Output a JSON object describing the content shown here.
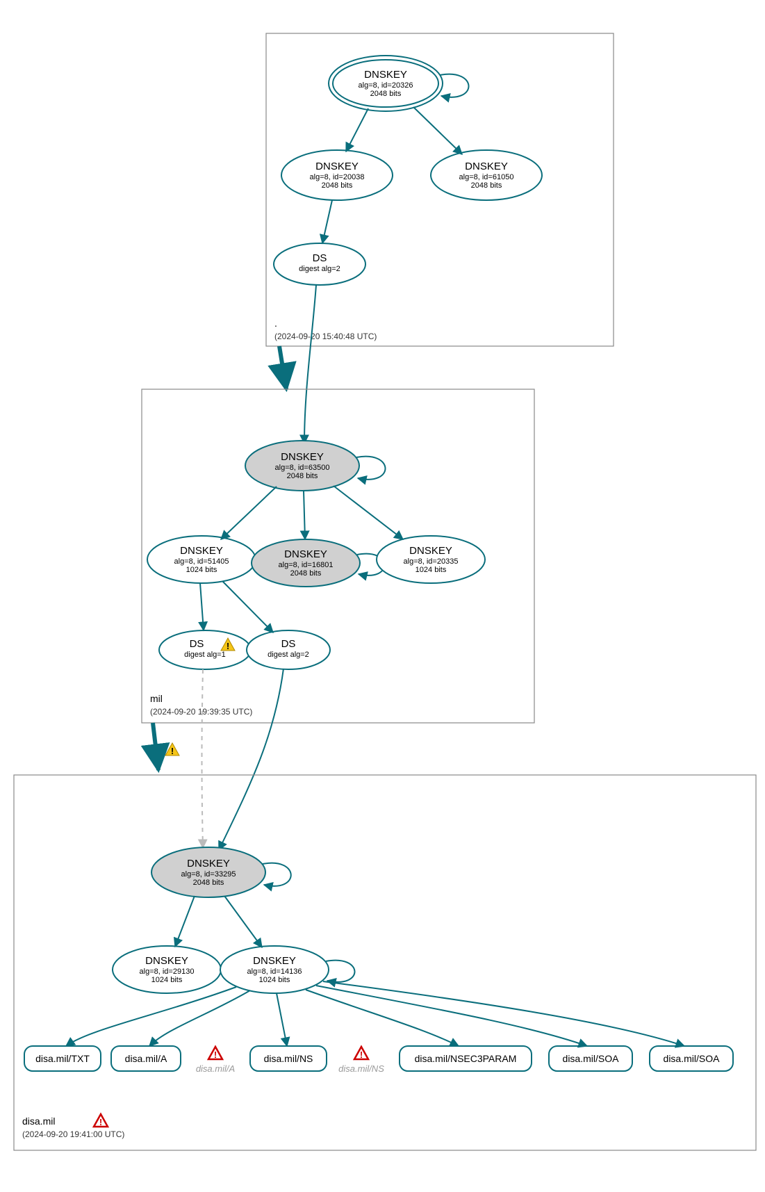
{
  "chart_data": {
    "type": "diagram",
    "note": "DNSSEC authentication / delegation graph with three zone containers (root, mil, disa.mil). Ellipse = key or DS, rounded rect = RRset, grey ellipse = key also present, double ellipse = trust anchor, thick arrow = zone delegation, dashed grey = insecure/unmatched link.",
    "zones": [
      {
        "id": "root",
        "timestamp": "(2024-09-20 15:40:48 UTC)"
      },
      {
        "id": "mil",
        "timestamp": "(2024-09-20 19:39:35 UTC)"
      },
      {
        "id": "disa.mil",
        "timestamp": "(2024-09-20 19:41:00 UTC)"
      }
    ],
    "nodes": [
      {
        "id": "root_ksk",
        "zone": "root",
        "title": "DNSKEY",
        "sub1": "alg=8, id=20326",
        "sub2": "2048 bits",
        "double": true
      },
      {
        "id": "root_k2",
        "zone": "root",
        "title": "DNSKEY",
        "sub1": "alg=8, id=20038",
        "sub2": "2048 bits"
      },
      {
        "id": "root_k3",
        "zone": "root",
        "title": "DNSKEY",
        "sub1": "alg=8, id=61050",
        "sub2": "2048 bits"
      },
      {
        "id": "root_ds",
        "zone": "root",
        "title": "DS",
        "sub1": "digest alg=2"
      },
      {
        "id": "mil_k1",
        "zone": "mil",
        "title": "DNSKEY",
        "sub1": "alg=8, id=63500",
        "sub2": "2048 bits",
        "grey": true
      },
      {
        "id": "mil_k2",
        "zone": "mil",
        "title": "DNSKEY",
        "sub1": "alg=8, id=51405",
        "sub2": "1024 bits"
      },
      {
        "id": "mil_k3",
        "zone": "mil",
        "title": "DNSKEY",
        "sub1": "alg=8, id=16801",
        "sub2": "2048 bits",
        "grey": true
      },
      {
        "id": "mil_k4",
        "zone": "mil",
        "title": "DNSKEY",
        "sub1": "alg=8, id=20335",
        "sub2": "1024 bits"
      },
      {
        "id": "mil_ds1",
        "zone": "mil",
        "title": "DS",
        "sub1": "digest alg=1",
        "warn": true
      },
      {
        "id": "mil_ds2",
        "zone": "mil",
        "title": "DS",
        "sub1": "digest alg=2"
      },
      {
        "id": "disa_k1",
        "zone": "disa.mil",
        "title": "DNSKEY",
        "sub1": "alg=8, id=33295",
        "sub2": "2048 bits",
        "grey": true
      },
      {
        "id": "disa_k2",
        "zone": "disa.mil",
        "title": "DNSKEY",
        "sub1": "alg=8, id=29130",
        "sub2": "1024 bits"
      },
      {
        "id": "disa_k3",
        "zone": "disa.mil",
        "title": "DNSKEY",
        "sub1": "alg=8, id=14136",
        "sub2": "1024 bits"
      },
      {
        "id": "rr_txt",
        "zone": "disa.mil",
        "title": "disa.mil/TXT",
        "shape": "rect"
      },
      {
        "id": "rr_a",
        "zone": "disa.mil",
        "title": "disa.mil/A",
        "shape": "rect"
      },
      {
        "id": "rr_a_ghost",
        "zone": "disa.mil",
        "title": "disa.mil/A",
        "shape": "ghost",
        "err": true
      },
      {
        "id": "rr_ns",
        "zone": "disa.mil",
        "title": "disa.mil/NS",
        "shape": "rect"
      },
      {
        "id": "rr_ns_ghost",
        "zone": "disa.mil",
        "title": "disa.mil/NS",
        "shape": "ghost",
        "err": true
      },
      {
        "id": "rr_nsec3",
        "zone": "disa.mil",
        "title": "disa.mil/NSEC3PARAM",
        "shape": "rect"
      },
      {
        "id": "rr_soa1",
        "zone": "disa.mil",
        "title": "disa.mil/SOA",
        "shape": "rect"
      },
      {
        "id": "rr_soa2",
        "zone": "disa.mil",
        "title": "disa.mil/SOA",
        "shape": "rect"
      }
    ],
    "edges": [
      {
        "from": "root_ksk",
        "to": "root_ksk",
        "self": true
      },
      {
        "from": "root_ksk",
        "to": "root_k2"
      },
      {
        "from": "root_ksk",
        "to": "root_k3"
      },
      {
        "from": "root_k2",
        "to": "root_ds"
      },
      {
        "from": "root",
        "to": "mil",
        "thick": true
      },
      {
        "from": "root_ds",
        "to": "mil_k1"
      },
      {
        "from": "mil_k1",
        "to": "mil_k1",
        "self": true
      },
      {
        "from": "mil_k1",
        "to": "mil_k2"
      },
      {
        "from": "mil_k1",
        "to": "mil_k3"
      },
      {
        "from": "mil_k3",
        "to": "mil_k3",
        "self": true
      },
      {
        "from": "mil_k1",
        "to": "mil_k4"
      },
      {
        "from": "mil_k2",
        "to": "mil_ds1"
      },
      {
        "from": "mil_k2",
        "to": "mil_ds2"
      },
      {
        "from": "mil",
        "to": "disa.mil",
        "thick": true,
        "warn": true
      },
      {
        "from": "mil_ds1",
        "to": "disa_k1",
        "dashed": true
      },
      {
        "from": "mil_ds2",
        "to": "disa_k1"
      },
      {
        "from": "disa_k1",
        "to": "disa_k1",
        "self": true
      },
      {
        "from": "disa_k1",
        "to": "disa_k2"
      },
      {
        "from": "disa_k1",
        "to": "disa_k3"
      },
      {
        "from": "disa_k3",
        "to": "disa_k3",
        "self": true
      },
      {
        "from": "disa_k3",
        "to": "rr_txt"
      },
      {
        "from": "disa_k3",
        "to": "rr_a"
      },
      {
        "from": "disa_k3",
        "to": "rr_ns"
      },
      {
        "from": "disa_k3",
        "to": "rr_nsec3"
      },
      {
        "from": "disa_k3",
        "to": "rr_soa1"
      },
      {
        "from": "disa_k3",
        "to": "rr_soa2"
      }
    ],
    "zone_error": {
      "zone": "disa.mil"
    }
  },
  "zones": {
    "root": {
      "label": ".",
      "time": "(2024-09-20 15:40:48 UTC)"
    },
    "mil": {
      "label": "mil",
      "time": "(2024-09-20 19:39:35 UTC)"
    },
    "disa": {
      "label": "disa.mil",
      "time": "(2024-09-20 19:41:00 UTC)"
    }
  },
  "root_ksk": {
    "t": "DNSKEY",
    "s1": "alg=8, id=20326",
    "s2": "2048 bits"
  },
  "root_k2": {
    "t": "DNSKEY",
    "s1": "alg=8, id=20038",
    "s2": "2048 bits"
  },
  "root_k3": {
    "t": "DNSKEY",
    "s1": "alg=8, id=61050",
    "s2": "2048 bits"
  },
  "root_ds": {
    "t": "DS",
    "s1": "digest alg=2"
  },
  "mil_k1": {
    "t": "DNSKEY",
    "s1": "alg=8, id=63500",
    "s2": "2048 bits"
  },
  "mil_k2": {
    "t": "DNSKEY",
    "s1": "alg=8, id=51405",
    "s2": "1024 bits"
  },
  "mil_k3": {
    "t": "DNSKEY",
    "s1": "alg=8, id=16801",
    "s2": "2048 bits"
  },
  "mil_k4": {
    "t": "DNSKEY",
    "s1": "alg=8, id=20335",
    "s2": "1024 bits"
  },
  "mil_ds1": {
    "t": "DS",
    "s1": "digest alg=1"
  },
  "mil_ds2": {
    "t": "DS",
    "s1": "digest alg=2"
  },
  "disa_k1": {
    "t": "DNSKEY",
    "s1": "alg=8, id=33295",
    "s2": "2048 bits"
  },
  "disa_k2": {
    "t": "DNSKEY",
    "s1": "alg=8, id=29130",
    "s2": "1024 bits"
  },
  "disa_k3": {
    "t": "DNSKEY",
    "s1": "alg=8, id=14136",
    "s2": "1024 bits"
  },
  "rr": {
    "txt": "disa.mil/TXT",
    "a": "disa.mil/A",
    "a_ghost": "disa.mil/A",
    "ns": "disa.mil/NS",
    "ns_ghost": "disa.mil/NS",
    "nsec3": "disa.mil/NSEC3PARAM",
    "soa1": "disa.mil/SOA",
    "soa2": "disa.mil/SOA"
  }
}
